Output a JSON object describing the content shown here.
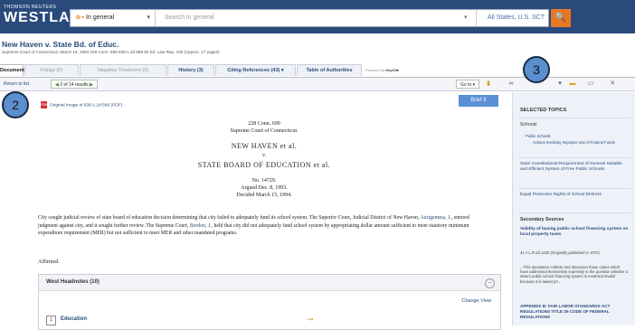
{
  "header": {
    "logo_small": "THOMSON REUTERS",
    "logo_big": "WESTLAW",
    "scope_label": "In general",
    "search_placeholder": "Search in general",
    "jurisdiction": "All States, U.S. SCT",
    "search_icon": "search-icon"
  },
  "case": {
    "title": "New Haven v. State Bd. of Educ.",
    "meta": "Supreme Court of Connecticut.   March 15, 1994   228 Conn. 699   638 A.2d 589   90 Ed. Law Rep. 236  (Approx. 17 pages)"
  },
  "tabs": [
    {
      "label": "Document"
    },
    {
      "label": "Filings (0)"
    },
    {
      "label": "Negative Treatment (0)"
    },
    {
      "label": "History (3)"
    },
    {
      "label": "Citing References (43)"
    },
    {
      "label": "Table of Authorities"
    }
  ],
  "powered_by": "Powered by",
  "keycite": "KeyCite",
  "toolbar": {
    "return": "Return to list",
    "results": "2 of 14 results",
    "goto": "Go to"
  },
  "badges": {
    "b2": "2",
    "b3": "3"
  },
  "doc": {
    "pdf_link": "Original Image of 638 A.2d 589 (PDF)",
    "brief_it": "Brief It",
    "citation": "228 Conn. 699",
    "court": "Supreme Court of Connecticut.",
    "party1": "NEW HAVEN et al.",
    "versus": "v.",
    "party2": "STATE BOARD OF EDUCATION et al.",
    "docket": "No. 14729.",
    "argued": "Argued Dec. 8, 1993.",
    "decided": "Decided March 15, 1994.",
    "para_1": "City sought judicial review of state board of education decision determining that city failed to adequately fund its school system. The Superior Court, Judicial District of New Haven,",
    "para_link1": "Aurigemma, J.",
    "para_2": ", entered judgment against city, and it sought further review. The Supreme Court,",
    "para_link2": "Berdon, J.",
    "para_3": ", held that city did not adequately fund school system by appropriating dollar amount sufficient to meet statutory minimum expenditure requirement (MER) but not sufficient to meet MER and other mandated programs.",
    "affirmed": "Affirmed."
  },
  "headnotes": {
    "title": "West Headnotes (10)",
    "change_view": "Change View",
    "first_num": "1",
    "first_label": "Education"
  },
  "sidebar": {
    "selected_topics": "SELECTED TOPICS",
    "schools": "Schools",
    "public_schools": "Public Schools",
    "actions": "Actions Involving Improper Use of Federal Funds",
    "constitutional": "State Constitutional Requirement of General Suitable and Efficient System of Free Public Schools",
    "equal": "Equal Protection Rights of School Districts",
    "secondary": "Secondary Sources",
    "validity": "Validity of basing public school financing system on local property taxes",
    "alr": "41 A.L.R.3d 1220 (Originally published in 1972)",
    "annotation": "...This annotation collects and discusses those cases which have addressed themselves expressly to the question whether a state's public school financing system is rendered invalid because it is based pri...",
    "appendix": "APPENDIX B: FAIR LABOR STANDARDS ACT REGULATIONS TITLE 29 CODE OF FEDERAL REGULATIONS"
  },
  "colors": {
    "header": "#2a4a7b",
    "accent": "#e87722",
    "link": "#2a4a7b",
    "badge": "#5b8fd0"
  }
}
